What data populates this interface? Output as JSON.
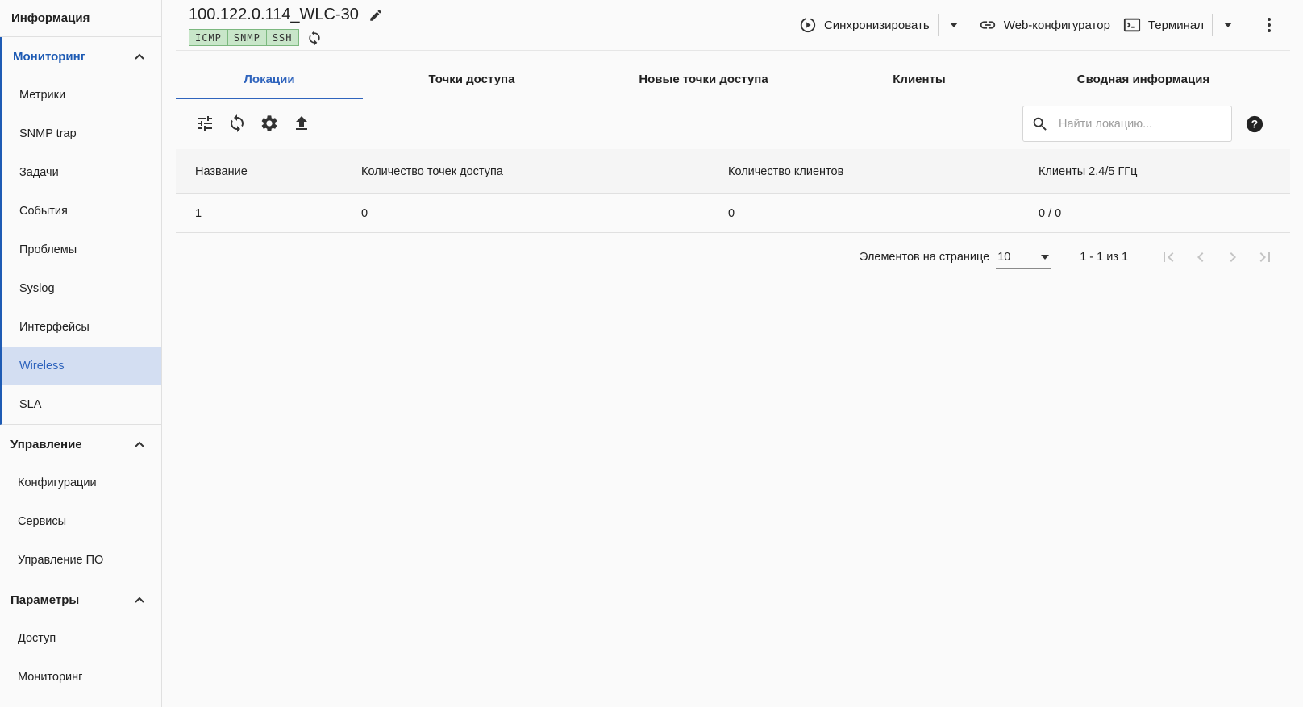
{
  "sidebar": {
    "header": "Информация",
    "groups": [
      {
        "label": "Мониторинг",
        "items": [
          "Метрики",
          "SNMP trap",
          "Задачи",
          "События",
          "Проблемы",
          "Syslog",
          "Интерфейсы",
          "Wireless",
          "SLA"
        ],
        "selected": "Wireless"
      },
      {
        "label": "Управление",
        "items": [
          "Конфигурации",
          "Сервисы",
          "Управление ПО"
        ]
      },
      {
        "label": "Параметры",
        "items": [
          "Доступ",
          "Мониторинг"
        ]
      }
    ]
  },
  "device": {
    "title": "100.122.0.114_WLC-30",
    "badges": [
      "ICMP",
      "SNMP",
      "SSH"
    ]
  },
  "actions": {
    "sync": "Синхронизировать",
    "web": "Web-конфигуратор",
    "terminal": "Терминал"
  },
  "tabs": [
    "Локации",
    "Точки доступа",
    "Новые точки доступа",
    "Клиенты",
    "Сводная информация"
  ],
  "active_tab": "Локации",
  "search": {
    "placeholder": "Найти локацию..."
  },
  "table": {
    "columns": [
      "Название",
      "Количество точек доступа",
      "Количество клиентов",
      "Клиенты 2.4/5 ГГц"
    ],
    "rows": [
      [
        "1",
        "0",
        "0",
        "0 / 0"
      ]
    ]
  },
  "paginator": {
    "per_page_label": "Элементов на странице",
    "per_page_value": "10",
    "range": "1 - 1 из 1"
  },
  "colors": {
    "accent": "#2f64bd",
    "selected_bg": "#d3def2",
    "badge_bg": "#c8e6c9"
  }
}
